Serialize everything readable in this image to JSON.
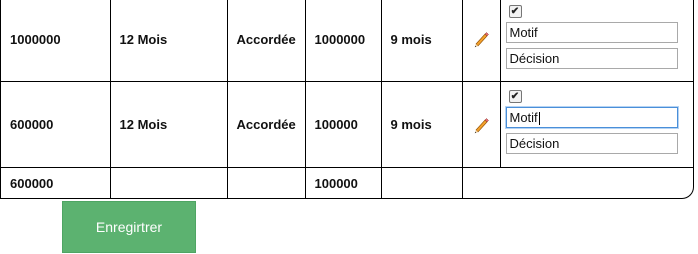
{
  "rows": [
    {
      "montant": "1000000",
      "duree": "12 Mois",
      "statut": "Accordée",
      "montant_accorde": "1000000",
      "duree_accordee": "9 mois",
      "checked": true,
      "motif": "Motif",
      "decision": "Décision"
    },
    {
      "montant": "600000",
      "duree": "12 Mois",
      "statut": "Accordée",
      "montant_accorde": "100000",
      "duree_accordee": "9 mois",
      "checked": true,
      "motif": "Motif",
      "decision": "Décision"
    }
  ],
  "totals": {
    "montant": "600000",
    "montant_accorde": "100000"
  },
  "actions": {
    "save_label": "Enregirtrer"
  },
  "colors": {
    "save_button": "#5cb270",
    "focus_border": "#4a8fd9"
  }
}
